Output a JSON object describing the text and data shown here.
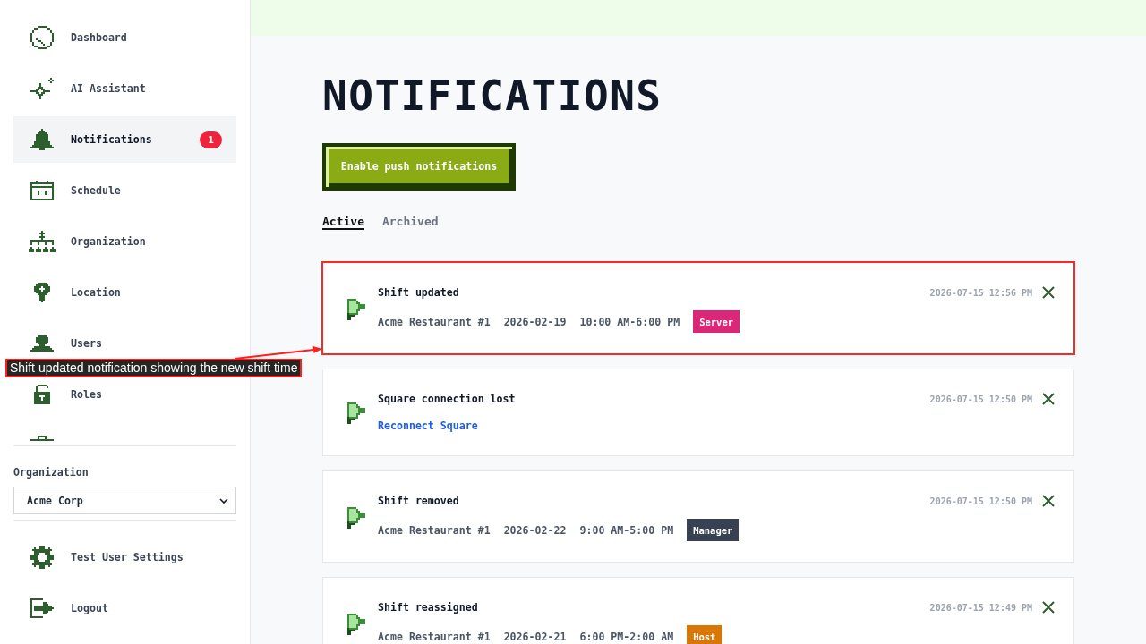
{
  "sidebar": {
    "nav_items": [
      {
        "label": "Dashboard",
        "selected": false
      },
      {
        "label": "AI Assistant",
        "selected": false
      },
      {
        "label": "Notifications",
        "selected": true,
        "badge": "1"
      },
      {
        "label": "Schedule",
        "selected": false
      },
      {
        "label": "Organization",
        "selected": false
      },
      {
        "label": "Location",
        "selected": false
      },
      {
        "label": "Users",
        "selected": false
      },
      {
        "label": "Roles",
        "selected": false
      }
    ],
    "organization": {
      "label": "Organization",
      "value": "Acme Corp"
    },
    "footer_items": [
      {
        "label": "Test User Settings",
        "selected": false
      },
      {
        "label": "Logout",
        "selected": false
      }
    ]
  },
  "page": {
    "title": "NOTIFICATIONS",
    "push_button": {
      "label": "Enable push notifications"
    },
    "tabs": [
      {
        "label": "Active",
        "selected": true
      },
      {
        "label": "Archived",
        "selected": false
      }
    ]
  },
  "notifications": [
    {
      "kind": "shift",
      "title": "Shift updated",
      "location": "Acme Restaurant #1",
      "date": "2026-02-19",
      "time": "10:00 AM-6:00 PM",
      "role": {
        "label": "Server",
        "color": "#db2777"
      },
      "timestamp": "2026-07-15 12:56 PM",
      "annotated": true
    },
    {
      "kind": "link",
      "title": "Square connection lost",
      "link": "Reconnect Square",
      "timestamp": "2026-07-15 12:50 PM",
      "annotated": false
    },
    {
      "kind": "shift",
      "title": "Shift removed",
      "location": "Acme Restaurant #1",
      "date": "2026-02-22",
      "time": "9:00 AM-5:00 PM",
      "role": {
        "label": "Manager",
        "color": "#374151"
      },
      "timestamp": "2026-07-15 12:50 PM",
      "annotated": false
    },
    {
      "kind": "shift",
      "title": "Shift reassigned",
      "location": "Acme Restaurant #1",
      "date": "2026-02-21",
      "time": "6:00 PM-2:00 AM",
      "role": {
        "label": "Host",
        "color": "#d97706"
      },
      "timestamp": "2026-07-15 12:49 PM",
      "annotated": false
    }
  ],
  "annotation": {
    "text": "Shift updated notification showing the new shift time"
  }
}
